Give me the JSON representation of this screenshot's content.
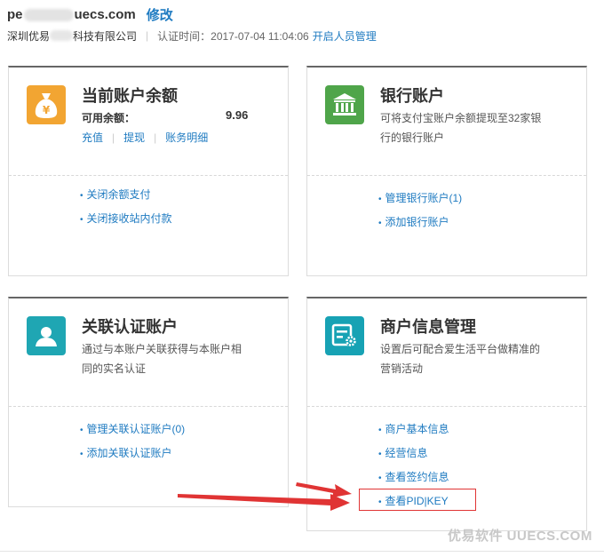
{
  "header": {
    "email_prefix": "pe",
    "email_suffix": "uecs.com",
    "modify_label": "修改",
    "company_prefix": "深圳优易",
    "company_suffix": "科技有限公司",
    "separator": "|",
    "cert_time": "认证时间：2017-07-04 11:04:06",
    "staff_link": "开启人员管理"
  },
  "cards": {
    "balance": {
      "title": "当前账户余额",
      "available_label": "可用余额：",
      "available_value": "9.96",
      "actions": [
        "充值",
        "提现",
        "账务明细"
      ],
      "links": [
        "关闭余额支付",
        "关闭接收站内付款"
      ]
    },
    "bank": {
      "title": "银行账户",
      "desc": "可将支付宝账户余额提现至32家银行的银行账户",
      "links": [
        "管理银行账户(1)",
        "添加银行账户"
      ]
    },
    "linked": {
      "title": "关联认证账户",
      "desc": "通过与本账户关联获得与本账户相同的实名认证",
      "links": [
        "管理关联认证账户(0)",
        "添加关联认证账户"
      ]
    },
    "merchant": {
      "title": "商户信息管理",
      "desc": "设置后可配合爱生活平台做精准的营销活动",
      "links": [
        "商户基本信息",
        "经营信息",
        "查看签约信息",
        "查看PID|KEY"
      ]
    }
  },
  "bullet": "•",
  "watermark": "优易软件 UUECS.COM",
  "colors": {
    "link": "#1f7bc1",
    "balance_icon": "#f2a532",
    "bank_icon": "#4fa54a",
    "linked_icon": "#1fa6b3",
    "merchant_icon": "#17a2b4",
    "annotation_red": "#e03434"
  },
  "icons": {
    "balance": "money-bag-icon",
    "bank": "bank-building-icon",
    "linked": "user-profile-icon",
    "merchant": "info-settings-icon"
  }
}
